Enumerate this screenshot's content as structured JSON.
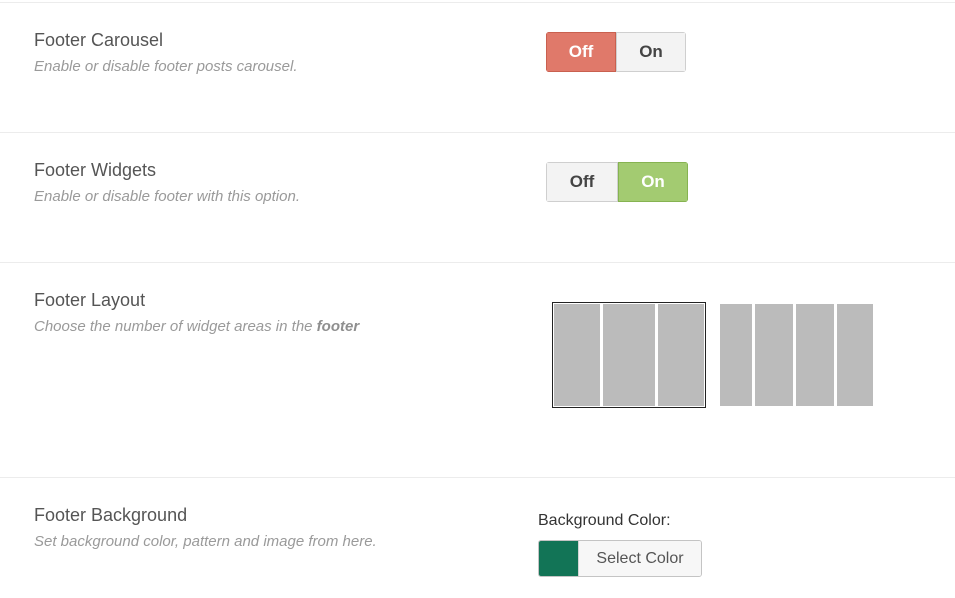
{
  "carousel": {
    "title": "Footer Carousel",
    "description": "Enable or disable footer posts carousel.",
    "off_label": "Off",
    "on_label": "On",
    "value": "Off"
  },
  "widgets": {
    "title": "Footer Widgets",
    "description": "Enable or disable footer with this option.",
    "off_label": "Off",
    "on_label": "On",
    "value": "On"
  },
  "layout": {
    "title": "Footer Layout",
    "description_prefix": "Choose the number of widget areas in the ",
    "description_emphasis": "footer",
    "options": [
      {
        "columns": 3,
        "selected": true
      },
      {
        "columns": 4,
        "selected": false
      }
    ]
  },
  "background": {
    "title": "Footer Background",
    "description": "Set background color, pattern and image from here.",
    "color_label": "Background Color:",
    "select_color_label": "Select Color",
    "color": "#127456"
  },
  "colors": {
    "off_active": "#e0796a",
    "on_active": "#a3cb71",
    "layout_column": "#bbbbbb"
  }
}
